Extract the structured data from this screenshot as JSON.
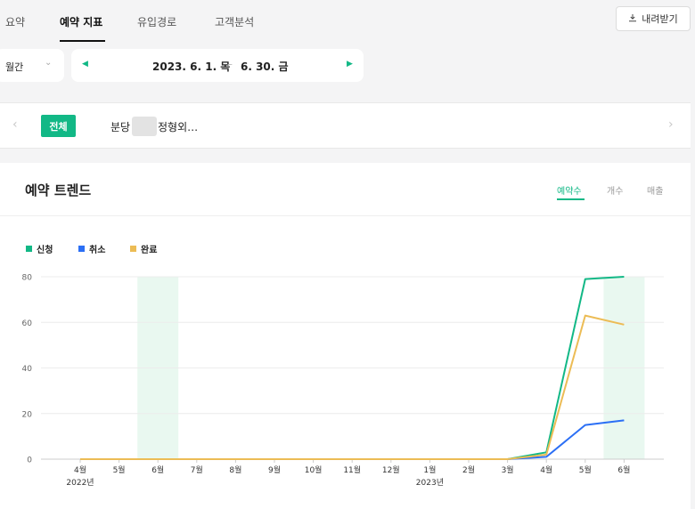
{
  "tabs": [
    {
      "label": "요약"
    },
    {
      "label": "예약 지표"
    },
    {
      "label": "유입경로"
    },
    {
      "label": "고객분석"
    }
  ],
  "download": {
    "label": "내려받기",
    "icon": "download-icon"
  },
  "period": {
    "selected": "월간"
  },
  "date_range": {
    "start": "2023. 6. 1. 목",
    "separator": "–",
    "end": "6. 30. 금"
  },
  "filter": {
    "all_label": "전체",
    "store_prefix": "분당",
    "store_suffix": "정형외…"
  },
  "card": {
    "title": "예약 트렌드",
    "metric_tabs": [
      {
        "label": "예약수",
        "active": true
      },
      {
        "label": "개수",
        "active": false
      },
      {
        "label": "매출",
        "active": false
      }
    ]
  },
  "colors": {
    "accent": "#12b886",
    "applied": "#12b886",
    "cancelled": "#2b6ff5",
    "completed": "#ecbc55"
  },
  "chart_data": {
    "type": "line",
    "x": [
      "4월",
      "5월",
      "6월",
      "7월",
      "8월",
      "9월",
      "10월",
      "11월",
      "12월",
      "1월",
      "2월",
      "3월",
      "4월",
      "5월",
      "6월"
    ],
    "year_labels": [
      {
        "index": 0,
        "label": "2022년"
      },
      {
        "index": 9,
        "label": "2023년"
      }
    ],
    "ylim": [
      0,
      80
    ],
    "yticks": [
      0,
      20,
      40,
      60,
      80
    ],
    "grid": true,
    "legend_position": "top-left",
    "highlight_months": [
      2,
      14
    ],
    "series": [
      {
        "name": "신청",
        "color": "#12b886",
        "values": [
          0,
          0,
          0,
          0,
          0,
          0,
          0,
          0,
          0,
          0,
          0,
          0,
          3,
          79,
          80
        ]
      },
      {
        "name": "취소",
        "color": "#2b6ff5",
        "values": [
          0,
          0,
          0,
          0,
          0,
          0,
          0,
          0,
          0,
          0,
          0,
          0,
          1,
          15,
          17
        ]
      },
      {
        "name": "완료",
        "color": "#ecbc55",
        "values": [
          0,
          0,
          0,
          0,
          0,
          0,
          0,
          0,
          0,
          0,
          0,
          0,
          2,
          63,
          59
        ]
      }
    ]
  }
}
